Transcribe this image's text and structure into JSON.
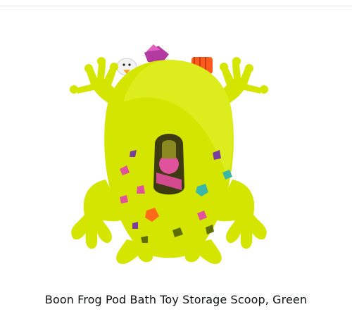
{
  "product": {
    "title": "Boon Frog Pod Bath Toy Storage Scoop, Green",
    "image_icon": "frog-pod-image",
    "colors": {
      "body": "#d4e600",
      "body_shadow": "#b9cc00",
      "holes": [
        "#e0529c",
        "#3bb7a8",
        "#ff6a1a",
        "#7a3ea0",
        "#5c6f00"
      ]
    }
  }
}
